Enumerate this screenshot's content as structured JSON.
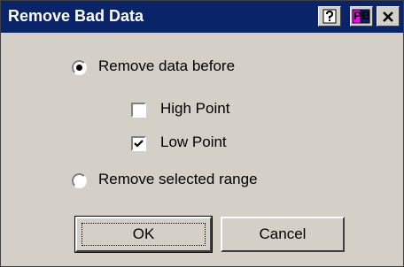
{
  "window": {
    "title": "Remove Bad Data",
    "title_buttons": [
      "help-icon",
      "pb-icon",
      "close-icon"
    ],
    "pb_text": "PB"
  },
  "options": {
    "remove_before": {
      "label": "Remove data before",
      "selected": true
    },
    "high_point": {
      "label": "High Point",
      "checked": false
    },
    "low_point": {
      "label": "Low Point",
      "checked": true
    },
    "remove_range": {
      "label": "Remove selected range",
      "selected": false
    }
  },
  "buttons": {
    "ok": "OK",
    "cancel": "Cancel"
  },
  "colors": {
    "titlebar": "#0a246a",
    "face": "#d4d0c8"
  }
}
